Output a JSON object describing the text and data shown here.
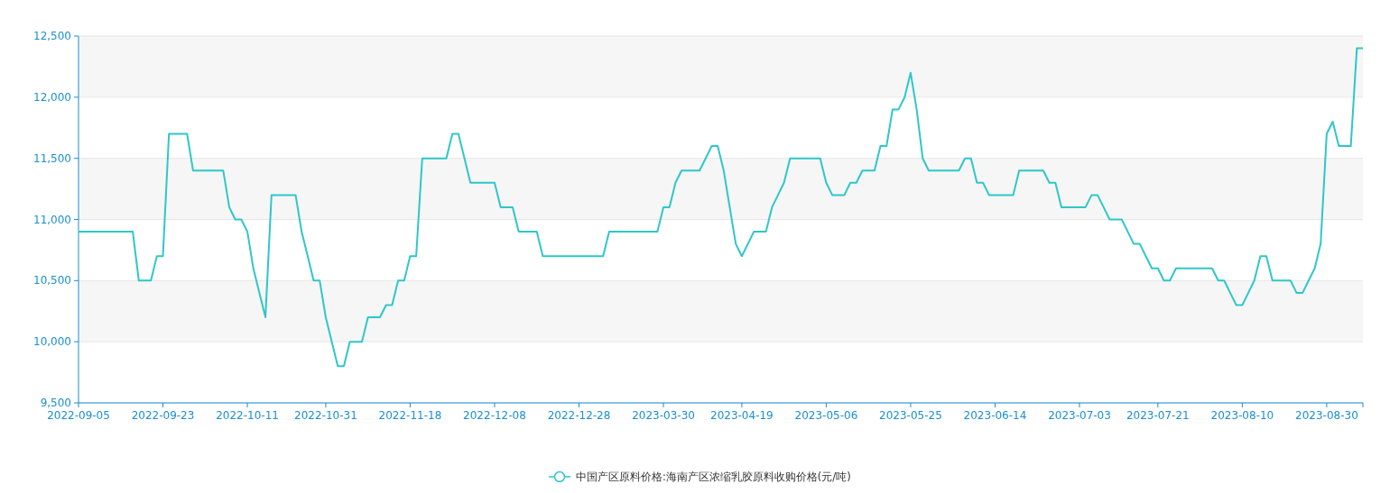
{
  "chart": {
    "chart_data": {
      "type": "line",
      "series": [
        {
          "name": "中国产区原料价格:海南产区浓缩乳胶原料收购价格(元/吨)",
          "color": "#2ec7c9",
          "values": [
            10900,
            10900,
            10900,
            10900,
            10900,
            10900,
            10900,
            10900,
            10900,
            10900,
            10500,
            10500,
            10500,
            10700,
            10700,
            11700,
            11700,
            11700,
            11700,
            11400,
            11400,
            11400,
            11400,
            11400,
            11400,
            11100,
            11000,
            11000,
            10900,
            10600,
            10400,
            10200,
            11200,
            11200,
            11200,
            11200,
            11200,
            10900,
            10700,
            10500,
            10500,
            10200,
            10000,
            9800,
            9800,
            10000,
            10000,
            10000,
            10200,
            10200,
            10200,
            10300,
            10300,
            10500,
            10500,
            10700,
            10700,
            11500,
            11500,
            11500,
            11500,
            11500,
            11700,
            11700,
            11500,
            11300,
            11300,
            11300,
            11300,
            11300,
            11100,
            11100,
            11100,
            10900,
            10900,
            10900,
            10900,
            10700,
            10700,
            10700,
            10700,
            10700,
            10700,
            10700,
            10700,
            10700,
            10700,
            10700,
            10900,
            10900,
            10900,
            10900,
            10900,
            10900,
            10900,
            10900,
            10900,
            11100,
            11100,
            11300,
            11400,
            11400,
            11400,
            11400,
            11500,
            11600,
            11600,
            11400,
            11100,
            10800,
            10700,
            10800,
            10900,
            10900,
            10900,
            11100,
            11200,
            11300,
            11500,
            11500,
            11500,
            11500,
            11500,
            11500,
            11300,
            11200,
            11200,
            11200,
            11300,
            11300,
            11400,
            11400,
            11400,
            11600,
            11600,
            11900,
            11900,
            12000,
            12200,
            11900,
            11500,
            11400,
            11400,
            11400,
            11400,
            11400,
            11400,
            11500,
            11500,
            11300,
            11300,
            11200,
            11200,
            11200,
            11200,
            11200,
            11400,
            11400,
            11400,
            11400,
            11400,
            11300,
            11300,
            11100,
            11100,
            11100,
            11100,
            11100,
            11200,
            11200,
            11100,
            11000,
            11000,
            11000,
            10900,
            10800,
            10800,
            10700,
            10600,
            10600,
            10500,
            10500,
            10600,
            10600,
            10600,
            10600,
            10600,
            10600,
            10600,
            10500,
            10500,
            10400,
            10300,
            10300,
            10400,
            10500,
            10700,
            10700,
            10500,
            10500,
            10500,
            10500,
            10400,
            10400,
            10500,
            10600,
            10800,
            11700,
            11800,
            11600,
            11600,
            11600,
            12400,
            12400
          ]
        }
      ],
      "grid": true,
      "ylim": [
        9500,
        12500
      ],
      "yticks": [
        {
          "value": 9500,
          "label": "9,500"
        },
        {
          "value": 10000,
          "label": "10,000"
        },
        {
          "value": 10500,
          "label": "10,500"
        },
        {
          "value": 11000,
          "label": "11,000"
        },
        {
          "value": 11500,
          "label": "11,500"
        },
        {
          "value": 12000,
          "label": "12,000"
        },
        {
          "value": 12500,
          "label": "12,500"
        }
      ],
      "categories": [
        "2022-09-05",
        null,
        null,
        null,
        null,
        null,
        null,
        null,
        null,
        null,
        null,
        null,
        null,
        null,
        "2022-09-23",
        null,
        null,
        null,
        null,
        null,
        null,
        null,
        null,
        null,
        null,
        null,
        null,
        null,
        "2022-10-11",
        null,
        null,
        null,
        null,
        null,
        null,
        null,
        null,
        null,
        null,
        null,
        null,
        "2022-10-31",
        null,
        null,
        null,
        null,
        null,
        null,
        null,
        null,
        null,
        null,
        null,
        null,
        null,
        "2022-11-18",
        null,
        null,
        null,
        null,
        null,
        null,
        null,
        null,
        null,
        null,
        null,
        null,
        null,
        "2022-12-08",
        null,
        null,
        null,
        null,
        null,
        null,
        null,
        null,
        null,
        null,
        null,
        null,
        null,
        "2022-12-28",
        null,
        null,
        null,
        null,
        null,
        null,
        null,
        null,
        null,
        null,
        null,
        null,
        null,
        "2023-03-30",
        null,
        null,
        null,
        null,
        null,
        null,
        null,
        null,
        null,
        null,
        null,
        null,
        "2023-04-19",
        null,
        null,
        null,
        null,
        null,
        null,
        null,
        null,
        null,
        null,
        null,
        null,
        null,
        "2023-05-06",
        null,
        null,
        null,
        null,
        null,
        null,
        null,
        null,
        null,
        null,
        null,
        null,
        null,
        "2023-05-25",
        null,
        null,
        null,
        null,
        null,
        null,
        null,
        null,
        null,
        null,
        null,
        null,
        null,
        "2023-06-14",
        null,
        null,
        null,
        null,
        null,
        null,
        null,
        null,
        null,
        null,
        null,
        null,
        null,
        "2023-07-03",
        null,
        null,
        null,
        null,
        null,
        null,
        null,
        null,
        null,
        null,
        null,
        null,
        "2023-07-21",
        null,
        null,
        null,
        null,
        null,
        null,
        null,
        null,
        null,
        null,
        null,
        null,
        null,
        "2023-08-10",
        null,
        null,
        null,
        null,
        null,
        null,
        null,
        null,
        null,
        null,
        null,
        null,
        null,
        "2023-08-30",
        null,
        null,
        null,
        null,
        null,
        null
      ]
    }
  }
}
